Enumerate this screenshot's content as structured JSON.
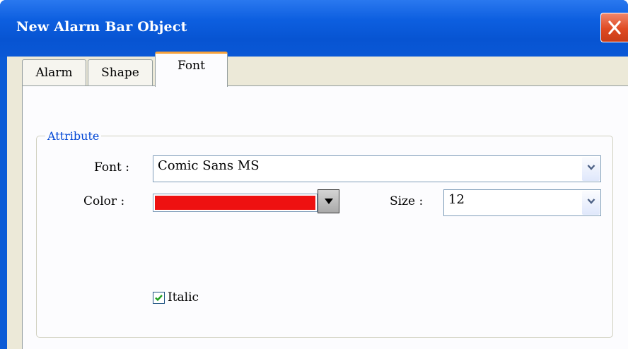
{
  "window": {
    "title": "New Alarm Bar Object",
    "close_icon": "close-icon"
  },
  "tabs": [
    {
      "label": "Alarm",
      "active": false
    },
    {
      "label": "Shape",
      "active": false
    },
    {
      "label": "Font",
      "active": true
    }
  ],
  "attribute": {
    "group_title": "Attribute",
    "font_label": "Font :",
    "font_value": "Comic Sans MS",
    "color_label": "Color :",
    "color_value": "#ee1111",
    "size_label": "Size :",
    "size_value": "12",
    "italic_label": "Italic",
    "italic_checked": true
  },
  "colors": {
    "titlebar": "#0754d2",
    "close_button": "#df4a22",
    "active_tab_accent": "#f7a23c",
    "group_title": "#0046d5",
    "dialog_bg": "#ece9d8"
  }
}
